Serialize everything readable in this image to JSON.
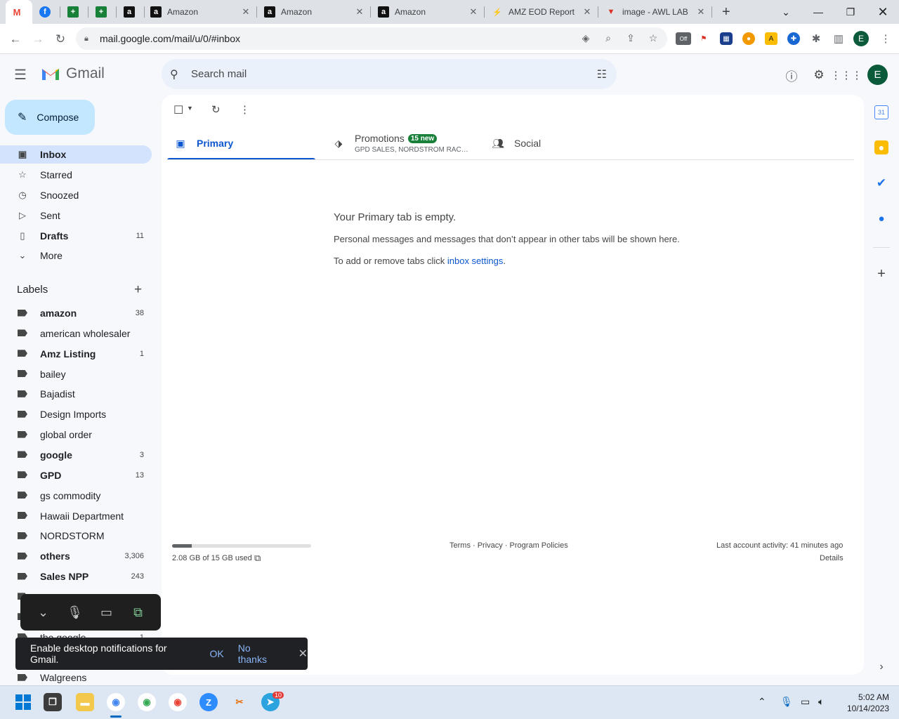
{
  "browser": {
    "tabs": [
      {
        "title": "",
        "icon": "gmail-icon"
      },
      {
        "title": "",
        "icon": "facebook-icon"
      },
      {
        "title": "",
        "icon": "sheets-icon"
      },
      {
        "title": "",
        "icon": "sheets-icon"
      },
      {
        "title": "",
        "icon": "amazon-icon"
      },
      {
        "title": "Amazon",
        "icon": "amazon-icon"
      },
      {
        "title": "Amazon",
        "icon": "amazon-icon"
      },
      {
        "title": "Amazon",
        "icon": "amazon-icon"
      },
      {
        "title": "AMZ EOD Report",
        "icon": "zapier-icon"
      },
      {
        "title": "image - AWL LAB",
        "icon": "awl-icon"
      }
    ],
    "url": "mail.google.com/mail/u/0/#inbox",
    "profile_initial": "E",
    "ext_off_label": "Off"
  },
  "gmail": {
    "brand": "Gmail",
    "search_placeholder": "Search mail",
    "avatar_initial": "E",
    "compose_label": "Compose",
    "nav": [
      {
        "label": "Inbox",
        "count": "",
        "icon": "inbox-icon"
      },
      {
        "label": "Starred",
        "count": "",
        "icon": "star-icon"
      },
      {
        "label": "Snoozed",
        "count": "",
        "icon": "clock-icon"
      },
      {
        "label": "Sent",
        "count": "",
        "icon": "send-icon"
      },
      {
        "label": "Drafts",
        "count": "11",
        "icon": "draft-icon"
      },
      {
        "label": "More",
        "count": "",
        "icon": "chevron-down-icon"
      }
    ],
    "labels_heading": "Labels",
    "labels": [
      {
        "label": "amazon",
        "count": "38",
        "bold": true
      },
      {
        "label": "american wholesaler",
        "count": "",
        "bold": false
      },
      {
        "label": "Amz Listing",
        "count": "1",
        "bold": true
      },
      {
        "label": "bailey",
        "count": "",
        "bold": false
      },
      {
        "label": "Bajadist",
        "count": "",
        "bold": false
      },
      {
        "label": "Design Imports",
        "count": "",
        "bold": false
      },
      {
        "label": "global order",
        "count": "",
        "bold": false
      },
      {
        "label": "google",
        "count": "3",
        "bold": true
      },
      {
        "label": "GPD",
        "count": "13",
        "bold": true
      },
      {
        "label": "gs commodity",
        "count": "",
        "bold": false
      },
      {
        "label": "Hawaii Department",
        "count": "",
        "bold": false
      },
      {
        "label": "NORDSTORM",
        "count": "",
        "bold": false
      },
      {
        "label": "others",
        "count": "3,306",
        "bold": true
      },
      {
        "label": "Sales NPP",
        "count": "243",
        "bold": true
      },
      {
        "label": "",
        "count": "",
        "bold": false
      },
      {
        "label": "",
        "count": "",
        "bold": false
      },
      {
        "label": "the google",
        "count": "1",
        "bold": false
      },
      {
        "label": "",
        "count": "",
        "bold": false
      },
      {
        "label": "Walgreens",
        "count": "",
        "bold": false
      }
    ],
    "inbox_tabs": {
      "primary": "Primary",
      "promotions": "Promotions",
      "promotions_badge": "15 new",
      "promotions_sub": "GPD SALES, NORDSTROM RAC…",
      "social": "Social"
    },
    "empty": {
      "title": "Your Primary tab is empty.",
      "line1": "Personal messages and messages that don’t appear in other tabs will be shown here.",
      "line2_prefix": "To add or remove tabs click ",
      "line2_link": "inbox settings",
      "line2_suffix": "."
    },
    "footer": {
      "storage_text": "2.08 GB of 15 GB used",
      "storage_fraction": 0.139,
      "policies": "Terms · Privacy · Program Policies",
      "activity": "Last account activity: 41 minutes ago",
      "details": "Details"
    },
    "snackbar": {
      "message": "Enable desktop notifications for Gmail.",
      "ok": "OK",
      "no_thanks": "No thanks"
    }
  },
  "taskbar": {
    "time": "5:02 AM",
    "date": "10/14/2023",
    "telegram_badge": "10"
  },
  "colors": {
    "accent": "#0b57d0",
    "compose_bg": "#c2e7ff",
    "selected_nav": "#d3e3fd",
    "badge_green": "#188038"
  }
}
